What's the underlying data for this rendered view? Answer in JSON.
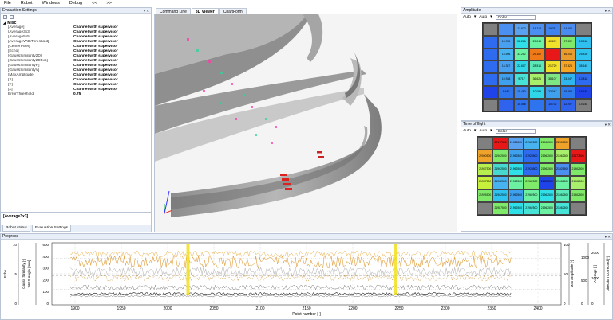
{
  "menu": [
    "File",
    "Robot",
    "Windows",
    "Debug",
    "<<",
    ">>"
  ],
  "eval_panel": {
    "title": "Evaluation Settings",
    "tools": "▾ ✕",
    "category": "Misc",
    "rows": [
      {
        "k": "[Average]",
        "v": "Channel with supervisor"
      },
      {
        "k": "[Average3x3]",
        "v": "Channel with supervisor"
      },
      {
        "k": "[Average5x5]",
        "v": "Channel with supervisor"
      },
      {
        "k": "[AverageWithThreshold]",
        "v": "Channel with supervisor"
      },
      {
        "k": "[CenterPixel]",
        "v": "Channel with supervisor"
      },
      {
        "k": "[Echo]",
        "v": "Channel with supervisor"
      },
      {
        "k": "[GaussSimilarity2D]",
        "v": "Channel with supervisor"
      },
      {
        "k": "[GaussSimilarity2D5x5]",
        "v": "Channel with supervisor"
      },
      {
        "k": "[GaussSimilarityH]",
        "v": "Channel with supervisor"
      },
      {
        "k": "[GaussSimilarityV]",
        "v": "Channel with supervisor"
      },
      {
        "k": "[MaxAmplitude]",
        "v": "Channel with supervisor"
      },
      {
        "k": "[X]",
        "v": "Channel with supervisor"
      },
      {
        "k": "[Y]",
        "v": "Channel with supervisor"
      },
      {
        "k": "[Z]",
        "v": "Channel with supervisor"
      },
      {
        "k": "ErrorThreshold",
        "v": "0.75"
      }
    ],
    "description": "[Average3x3]",
    "bottom_tabs": [
      "Robot status",
      "Evaluation Settings"
    ]
  },
  "doc_tabs": [
    "Command Line",
    "3D Viewer",
    "ChartForm"
  ],
  "amplitude": {
    "title": "Amplitude",
    "tools": "▾ ✕",
    "scale_a": "Auto",
    "scale_b": "Auto",
    "colormode": "Color",
    "cells": [
      [
        "",
        "",
        "13.672",
        "16.113",
        "16.211",
        "14.600",
        ""
      ],
      [
        "",
        "15.780",
        "22.266",
        "29.048",
        "40.674",
        "27.832",
        "13.818"
      ],
      [
        "",
        "15.596",
        "33.252",
        "29.102",
        "",
        "46.045",
        "25.830"
      ],
      [
        "",
        "16.357",
        "22.607",
        "28.516",
        "21.729",
        "37.324",
        "35.645"
      ],
      [
        "",
        "10.938",
        "9.717",
        "36.621",
        "38.107",
        "23.047",
        "13.818"
      ],
      [
        "",
        "9.640",
        "15.480",
        "10.059",
        "23.047",
        "15.088",
        "16.748"
      ],
      [
        "",
        "",
        "10.068",
        "",
        "10.732",
        "12.207",
        "14.648"
      ]
    ],
    "colors": [
      [
        "#808080",
        "#4b8ff0",
        "#5aa2f0",
        "#4b8ff0",
        "#3f83ef",
        "#4a8bf0",
        "#808080"
      ],
      [
        "#2f6bee",
        "#4aa0f0",
        "#2fe0e9",
        "#6bf2a0",
        "#f0e12a",
        "#7fe96a",
        "#2fc0f0"
      ],
      [
        "#2f6bee",
        "#47b3f0",
        "#6cf0a2",
        "#f07a17",
        "#e81818",
        "#e99b2c",
        "#2fc4ef"
      ],
      [
        "#2f6bee",
        "#4aa0f0",
        "#2fd7e9",
        "#5be9b7",
        "#f0e02a",
        "#f5a523",
        "#3ac0ef"
      ],
      [
        "#2f6bee",
        "#3fa0ee",
        "#47e3d6",
        "#a8f06b",
        "#7de784",
        "#2fb6ef",
        "#2f6bee"
      ],
      [
        "#1f43e8",
        "#2f74ef",
        "#3b87ef",
        "#2fd6e9",
        "#3fa0ee",
        "#2f7bee",
        "#1f43e8"
      ],
      [
        "#808080",
        "#2f63ee",
        "#2f72ef",
        "#2f74ef",
        "#2f6bee",
        "#2f63ee",
        "#808080"
      ]
    ]
  },
  "tof": {
    "title": "Time of flight",
    "tools": "▾ ✕",
    "scale_a": "Auto",
    "scale_b": "Auto",
    "colormode": "Color",
    "cells": [
      [
        "",
        "22177\n500",
        "21925\n500",
        "21962\n500",
        "21962\n500",
        "22000\n500",
        ""
      ],
      [
        "22000\n500",
        "21962\n500",
        "21962\n500",
        "21925\n500",
        "21962\n500",
        "21962\n500",
        "22177\n500"
      ],
      [
        "21987\n500",
        "21962\n500",
        "21962\n500",
        "21925\n500",
        "21962\n500",
        "21925\n500",
        "21962\n500"
      ],
      [
        "21987\n500",
        "21962\n500",
        "21962\n500",
        "21962\n500",
        "21925\n500",
        "21962\n500",
        "21962\n500"
      ],
      [
        "21925\n500",
        "21962\n500",
        "21962\n500",
        "21962\n500",
        "21962\n500",
        "21962\n500",
        "21962\n500"
      ],
      [
        "",
        "21987\n500",
        "21962\n500",
        "21962\n500",
        "21962\n500",
        "21962\n500",
        ""
      ]
    ],
    "colors": [
      [
        "#808080",
        "#e81818",
        "#5aa2f0",
        "#47b3f0",
        "#7fe96a",
        "#f0a32a",
        "#808080"
      ],
      [
        "#f0a32a",
        "#7fe96a",
        "#3fa0ee",
        "#2f6bee",
        "#7fe96a",
        "#a8f06b",
        "#e81818"
      ],
      [
        "#b7f04e",
        "#47d9d0",
        "#2fe0e9",
        "#2f6bee",
        "#7fe96a",
        "#4b8ff0",
        "#7fe96a"
      ],
      [
        "#c7f03c",
        "#47b3f0",
        "#6cf0a2",
        "#7fe96a",
        "#1f43e8",
        "#6cf0a2",
        "#a8f06b"
      ],
      [
        "#7fe96a",
        "#2fc4ef",
        "#3fa0ee",
        "#6cf0a2",
        "#2fe0e9",
        "#5be9b7",
        "#7fe96a"
      ],
      [
        "#808080",
        "#7fe96a",
        "#2fe0e9",
        "#47e3d6",
        "#6cf0a2",
        "#47e3d6",
        "#808080"
      ]
    ]
  },
  "progress": {
    "title": "Progress",
    "tools": "▾ ✕",
    "xlabel": "Point number [-]",
    "x_ticks": [
      "1900",
      "1950",
      "2000",
      "2050",
      "2100",
      "2150",
      "2200",
      "2250",
      "2300",
      "2350",
      "2400"
    ],
    "left_axis_labels": [
      "Echo",
      "Gauss Similarity [-]",
      "WGS Angle [mm]"
    ],
    "left_ticks_a": [
      "10",
      "5",
      "0"
    ],
    "left_ticks_b": [
      "600",
      "400",
      "300",
      "200",
      "100",
      "0"
    ],
    "right_axis_labels": [
      "Max Amplitude [-]",
      "Average [-]",
      "Direction Corrected [-]"
    ],
    "right_ticks_a": [
      "100",
      "50",
      "0"
    ],
    "right_ticks_b": [
      "1000",
      "500",
      "0"
    ],
    "right_ticks_c": [
      "2000",
      "1000",
      "0"
    ]
  }
}
